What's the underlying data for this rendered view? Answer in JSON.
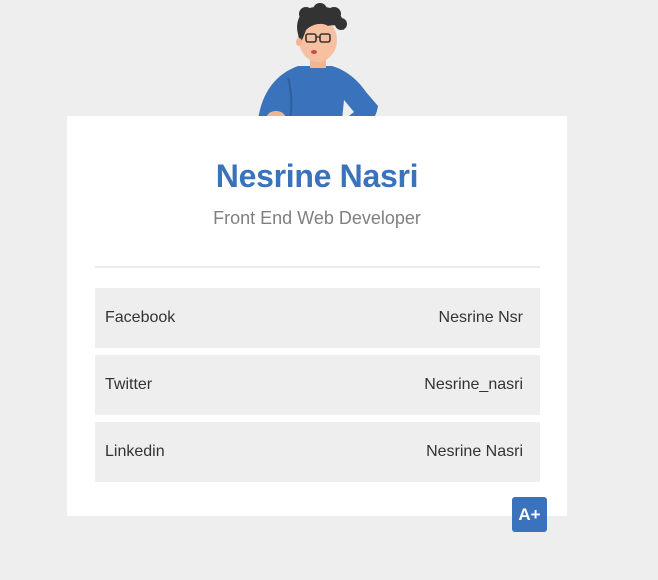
{
  "profile": {
    "name": "Nesrine Nasri",
    "role": "Front End Web Developer"
  },
  "social": [
    {
      "network": "Facebook",
      "handle": "Nesrine Nsr"
    },
    {
      "network": "Twitter",
      "handle": "Nesrine_nasri"
    },
    {
      "network": "Linkedin",
      "handle": "Nesrine Nasri"
    }
  ],
  "accessibility": {
    "label": "A+"
  },
  "colors": {
    "page_bg": "#eeeeee",
    "card_bg": "#ffffff",
    "accent": "#3a72bb",
    "row_bg": "#eeeeee"
  },
  "icons": {
    "avatar": "person-illustration-icon"
  }
}
